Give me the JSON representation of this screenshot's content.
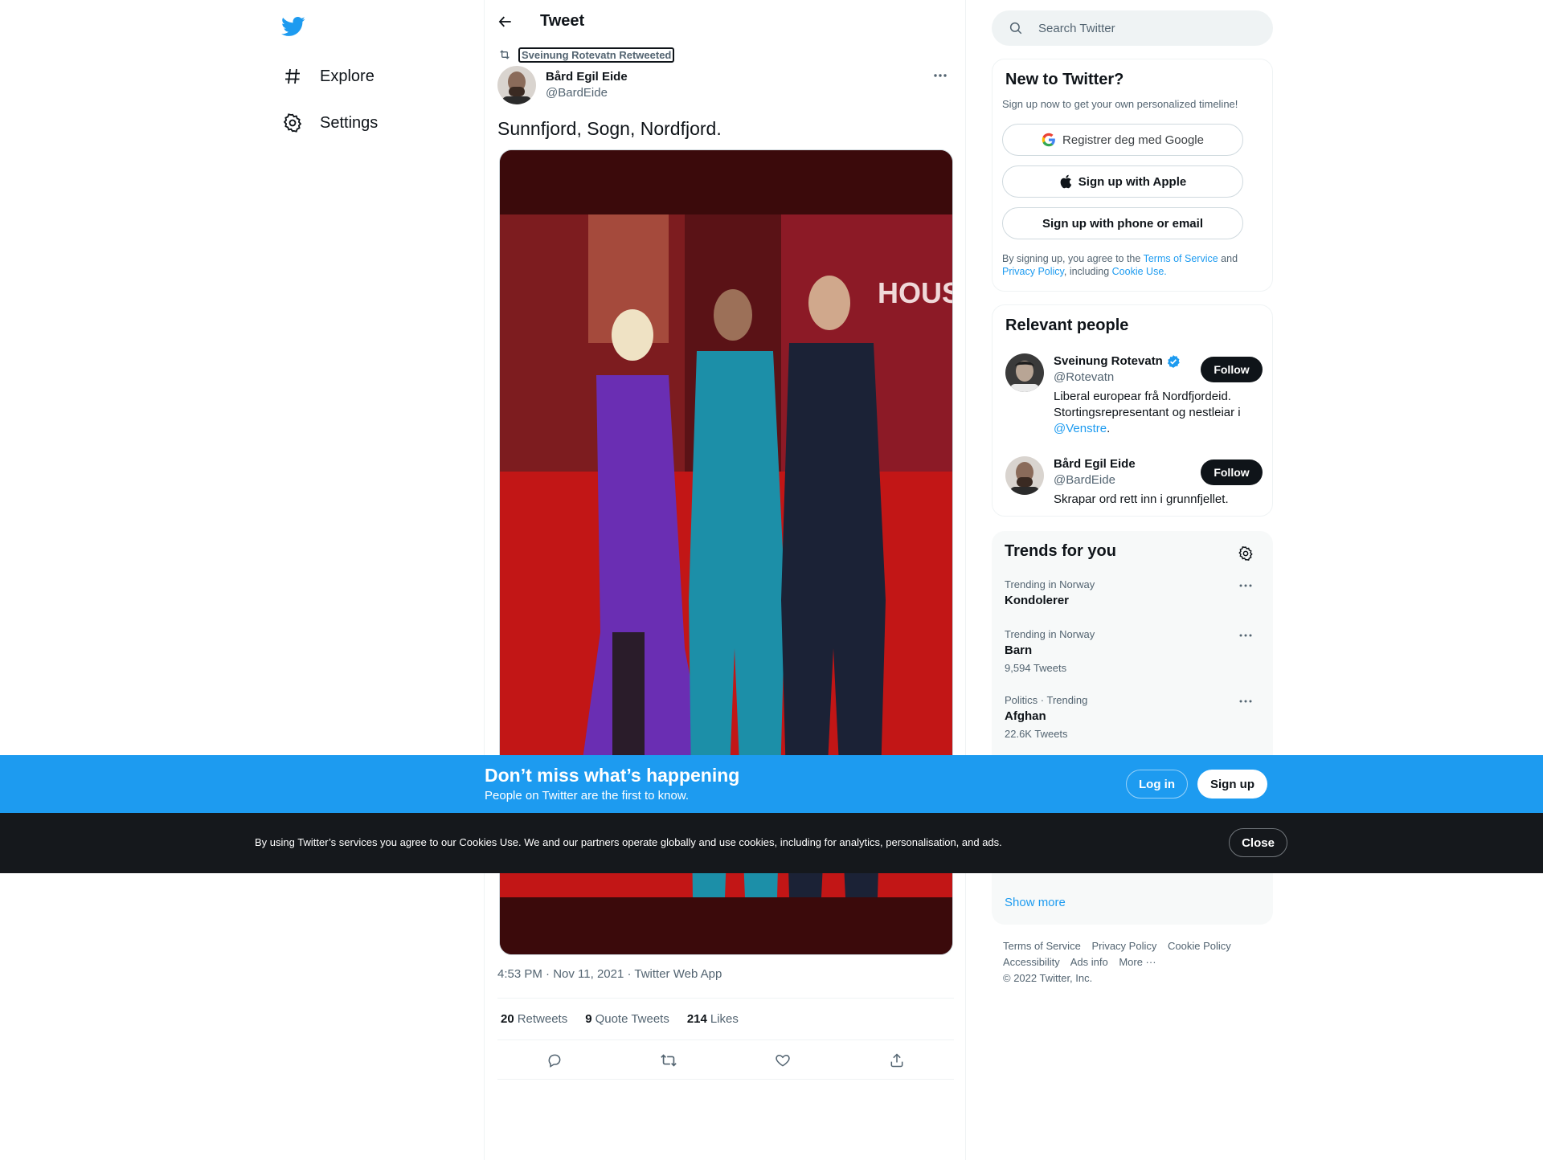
{
  "nav": {
    "logo": "twitter-bird-icon",
    "items": [
      {
        "label": "Explore",
        "icon": "hashtag-icon"
      },
      {
        "label": "Settings",
        "icon": "gear-icon"
      }
    ]
  },
  "header": {
    "title": "Tweet"
  },
  "tweet": {
    "retweeted_by": "Sveinung Rotevatn Retweeted",
    "author_name": "Bård Egil Eide",
    "author_handle": "@BardEide",
    "text": "Sunnfjord, Sogn, Nordfjord.",
    "timestamp": "4:53 PM · Nov 11, 2021 · Twitter Web App",
    "stats": [
      {
        "count": "20",
        "label": "Retweets"
      },
      {
        "count": "9",
        "label": "Quote Tweets"
      },
      {
        "count": "214",
        "label": "Likes"
      }
    ]
  },
  "search": {
    "placeholder": "Search Twitter"
  },
  "new_to_twitter": {
    "title": "New to Twitter?",
    "subtitle": "Sign up now to get your own personalized timeline!",
    "google_label": "Registrer deg med Google",
    "apple_label": "Sign up with Apple",
    "phone_label": "Sign up with phone or email",
    "legal_prefix": "By signing up, you agree to the",
    "legal_terms": "Terms of Service",
    "legal_and": "and",
    "legal_privacy": "Privacy Policy",
    "legal_including": ", including",
    "legal_cookie": "Cookie Use."
  },
  "relevant_people": {
    "title": "Relevant people",
    "people": [
      {
        "name": "Sveinung Rotevatn",
        "handle": "@Rotevatn",
        "bio": "Liberal europear frå Nordfjordeid. Stortingsrepresentant og nestleiar i",
        "bio_mention": "@Venstre",
        "bio_end": ".",
        "follow": "Follow"
      },
      {
        "name": "Bård Egil Eide",
        "handle": "@BardEide",
        "bio": "Skrapar ord rett inn i grunnfjellet.",
        "follow": "Follow"
      }
    ]
  },
  "trends": {
    "title": "Trends for you",
    "items": [
      {
        "category": "Trending in Norway",
        "name": "Kondolerer",
        "count": ""
      },
      {
        "category": "Trending in Norway",
        "name": "Barn",
        "count": "9,594 Tweets"
      },
      {
        "category": "Politics · Trending",
        "name": "Afghan",
        "count": "22.6K Tweets"
      }
    ],
    "show_more": "Show more"
  },
  "footer": {
    "links": [
      "Terms of Service",
      "Privacy Policy",
      "Cookie Policy",
      "Accessibility",
      "Ads info",
      "More ···"
    ],
    "copyright": "© 2022 Twitter, Inc."
  },
  "signup_bar": {
    "title": "Don’t miss what’s happening",
    "subtitle": "People on Twitter are the first to know.",
    "login": "Log in",
    "signup": "Sign up"
  },
  "cookie_bar": {
    "text": "By using Twitter’s services you agree to our Cookies Use. We and our partners operate globally and use cookies, including for analytics, personalisation, and ads.",
    "close": "Close"
  },
  "colors": {
    "brand": "#1d9bf0",
    "text": "#0f1419",
    "secondary": "#536471",
    "cookie_bg": "#15181c"
  }
}
